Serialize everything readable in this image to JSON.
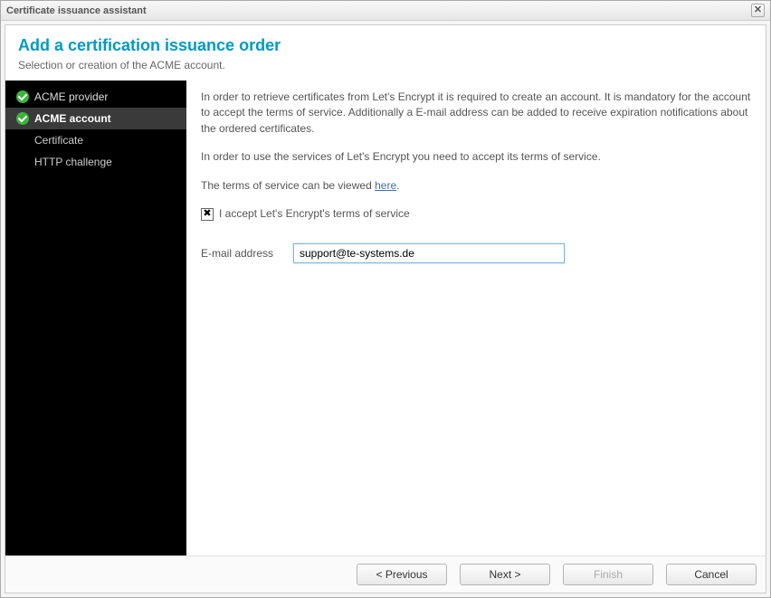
{
  "window": {
    "title": "Certificate issuance assistant"
  },
  "header": {
    "title": "Add a certification issuance order",
    "subtitle": "Selection or creation of the ACME account."
  },
  "sidebar": {
    "items": [
      {
        "label": "ACME provider",
        "state": "completed"
      },
      {
        "label": "ACME account",
        "state": "active"
      },
      {
        "label": "Certificate",
        "state": "pending"
      },
      {
        "label": "HTTP challenge",
        "state": "pending"
      }
    ]
  },
  "content": {
    "paragraph1": "In order to retrieve certificates from Let's Encrypt it is required to create an account. It is mandatory for the account to accept the terms of service. Additionally a E-mail address can be added to receive expiration notifications about the ordered certificates.",
    "paragraph2": "In order to use the services of Let's Encrypt you need to accept its terms of service.",
    "tos_prefix": "The terms of service can be viewed ",
    "tos_link": "here",
    "tos_suffix": ".",
    "accept_label": "I accept Let's Encrypt's terms of service",
    "accept_checked": true,
    "email_label": "E-mail address",
    "email_value": "support@te-systems.de"
  },
  "footer": {
    "previous": "< Previous",
    "next": "Next >",
    "finish": "Finish",
    "cancel": "Cancel"
  }
}
